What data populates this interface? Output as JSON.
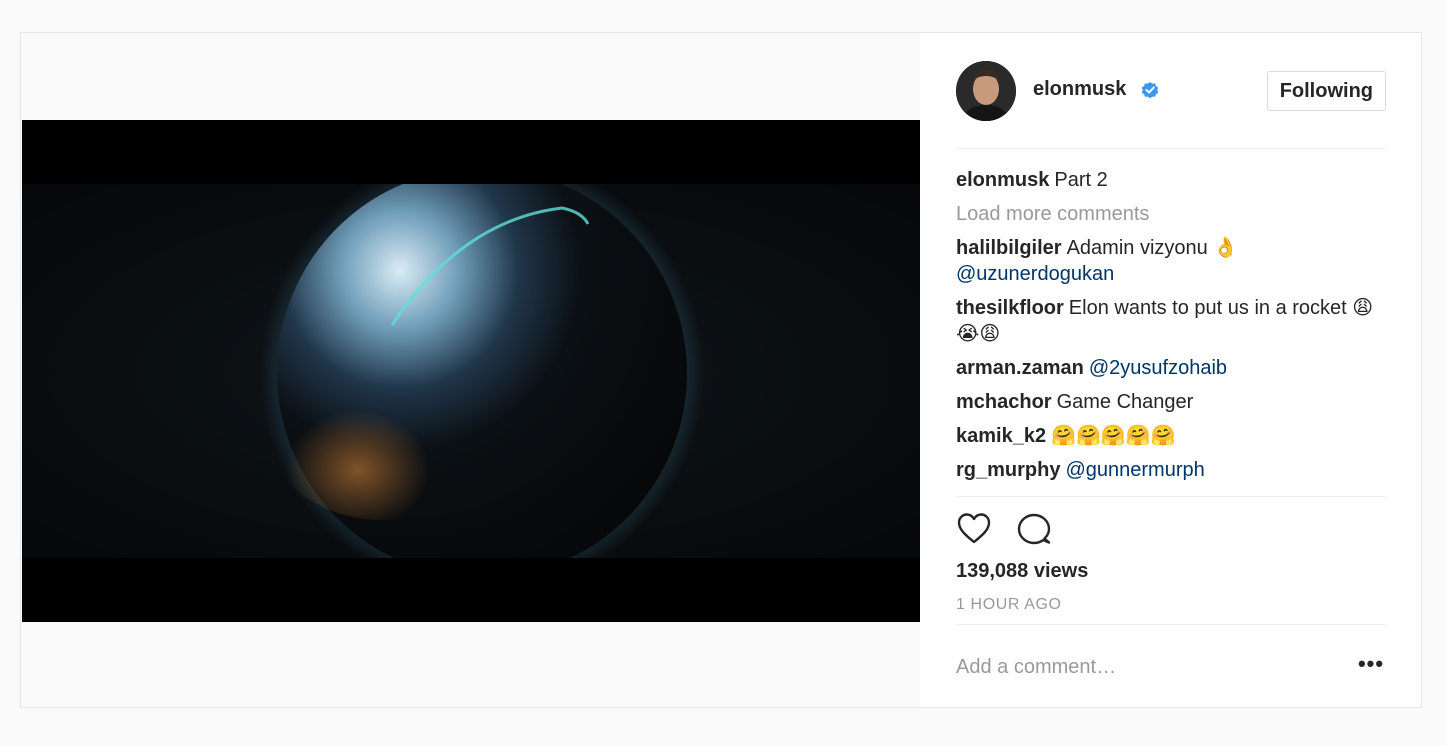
{
  "post": {
    "author": "elonmusk",
    "follow_label": "Following",
    "caption": {
      "user": "elonmusk",
      "text": "Part 2"
    },
    "load_more_label": "Load more comments",
    "comments": [
      {
        "user": "halilbilgiler",
        "text": "Adamin vizyonu 👌",
        "mention": "@uzunerdogukan"
      },
      {
        "user": "thesilkfloor",
        "text": "Elon wants to put us in a rocket 😩😭😩",
        "mention": ""
      },
      {
        "user": "arman.zaman",
        "text": "",
        "mention": "@2yusufzohaib"
      },
      {
        "user": "mchachor",
        "text": "Game Changer",
        "mention": ""
      },
      {
        "user": "kamik_k2",
        "text": "🤗🤗🤗🤗🤗",
        "mention": ""
      },
      {
        "user": "rg_murphy",
        "text": "",
        "mention": "@gunnermurph"
      }
    ],
    "views": "139,088 views",
    "timestamp": "1 HOUR AGO",
    "add_comment_placeholder": "Add a comment…",
    "more_label": "•••"
  },
  "icons": {
    "verified": "verified-badge-icon",
    "like": "heart-icon",
    "comment": "comment-bubble-icon",
    "more": "more-options-icon"
  },
  "colors": {
    "verified_blue": "#3897f0",
    "mention": "#003569",
    "muted": "#999999",
    "text": "#262626",
    "border": "#dbdbdb"
  }
}
